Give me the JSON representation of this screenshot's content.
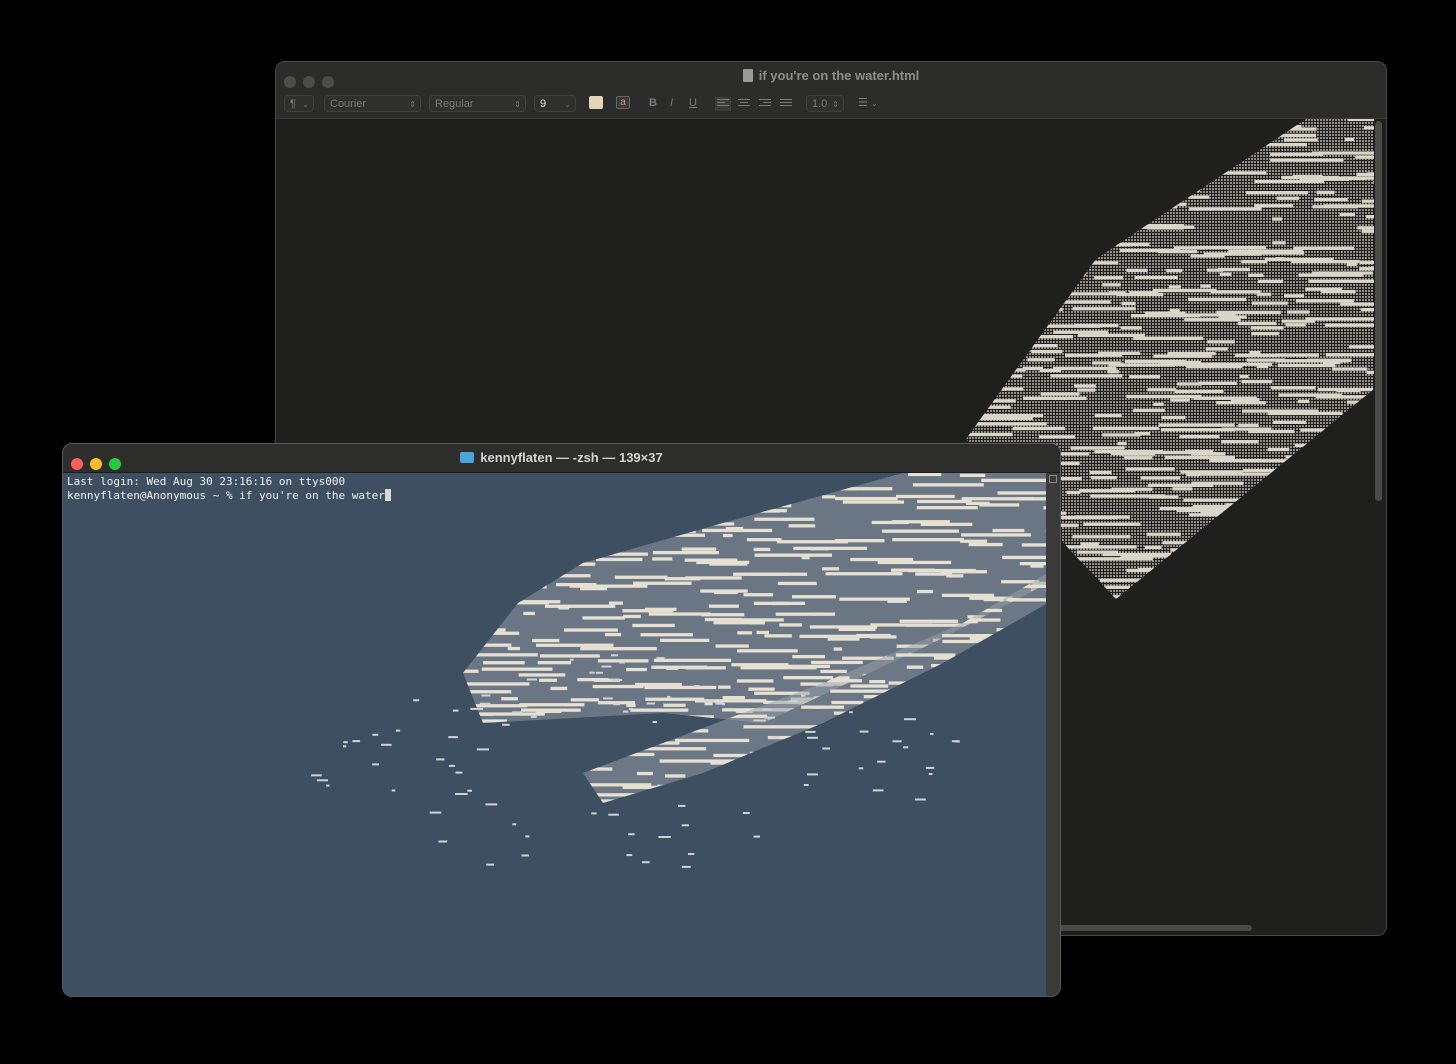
{
  "textedit": {
    "title": "if you're on the water.html",
    "toolbar": {
      "paragraph_style": "¶",
      "font_family": "Courier",
      "font_style": "Regular",
      "font_size": "9",
      "text_color": "#e6d3bb",
      "bold": "B",
      "italic": "I",
      "underline": "U",
      "line_spacing": "1.0"
    }
  },
  "terminal": {
    "title": "kennyflaten — -zsh — 139×37",
    "lines": [
      "Last login: Wed Aug 30 23:16:16 on ttys000",
      "kennyflaten@Anonymous ~ % if you're on the water"
    ]
  },
  "colors": {
    "terminal_background": "#3f4f62",
    "textedit_background": "#1f1f1e",
    "ascii_art": "#ddd8cc"
  }
}
